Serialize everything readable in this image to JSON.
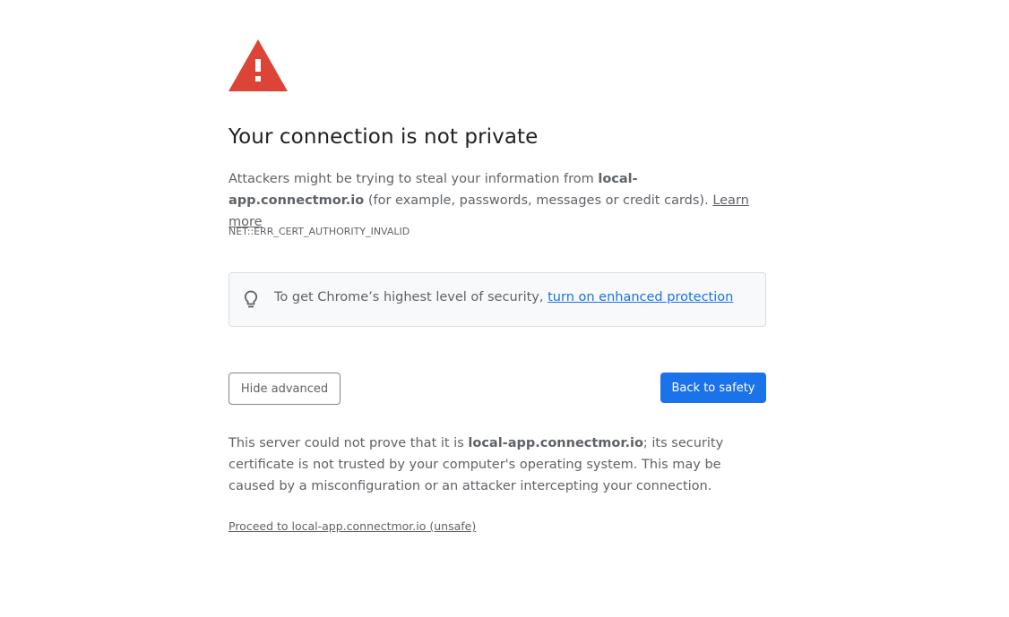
{
  "page": {
    "title": "Your connection is not private",
    "icons": {
      "warning": "warning-triangle-icon",
      "bulb": "lightbulb-icon"
    },
    "colors": {
      "warning_red": "#db4437",
      "primary_blue": "#1a73e8",
      "text": "#5f6368",
      "heading": "#202124"
    }
  },
  "description": {
    "prefix": "Attackers might be trying to steal your information from ",
    "host": "local-app.connectmor.io",
    "suffix": " (for example, passwords, messages or credit cards). ",
    "learn_more": "Learn more"
  },
  "error_code": "NET::ERR_CERT_AUTHORITY_INVALID",
  "enhanced": {
    "text": "To get Chrome’s highest level of security, ",
    "link": "turn on enhanced protection"
  },
  "buttons": {
    "hide_advanced": "Hide advanced",
    "back_to_safety": "Back to safety"
  },
  "details": {
    "prefix": "This server could not prove that it is ",
    "host": "local-app.connectmor.io",
    "suffix": "; its security certificate is not trusted by your computer's operating system. This may be caused by a misconfiguration or an attacker intercepting your connection."
  },
  "proceed_link": "Proceed to local-app.connectmor.io (unsafe)"
}
